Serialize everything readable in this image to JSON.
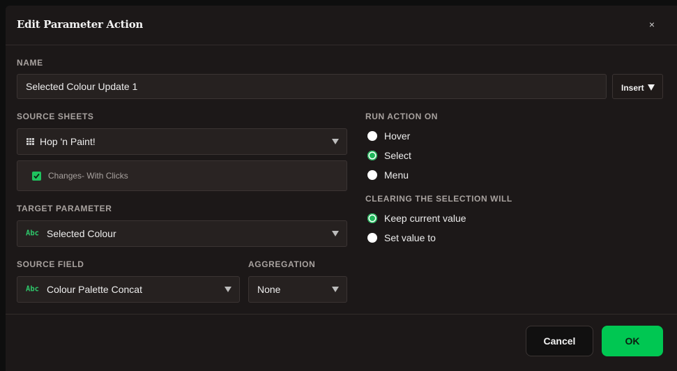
{
  "dialog": {
    "title": "Edit Parameter Action",
    "close_glyph": "×"
  },
  "name": {
    "label": "NAME",
    "value": "Selected Colour Update 1",
    "insert_label": "Insert"
  },
  "source_sheets": {
    "label": "SOURCE SHEETS",
    "selected": "Hop 'n Paint!",
    "icon": "sheet-grid-icon",
    "sheet_checkbox": {
      "label": "Changes- With Clicks",
      "checked": true
    }
  },
  "target_parameter": {
    "label": "TARGET PARAMETER",
    "type_badge": "Abc",
    "value": "Selected Colour"
  },
  "source_field": {
    "label": "SOURCE FIELD",
    "type_badge": "Abc",
    "value": "Colour Palette Concat"
  },
  "aggregation": {
    "label": "AGGREGATION",
    "value": "None"
  },
  "run_action_on": {
    "label": "RUN ACTION ON",
    "options": [
      {
        "label": "Hover",
        "selected": false
      },
      {
        "label": "Select",
        "selected": true
      },
      {
        "label": "Menu",
        "selected": false
      }
    ]
  },
  "clearing": {
    "label": "CLEARING THE SELECTION WILL",
    "options": [
      {
        "label": "Keep current value",
        "selected": true
      },
      {
        "label": "Set value to",
        "selected": false
      }
    ]
  },
  "footer": {
    "cancel_label": "Cancel",
    "ok_label": "OK"
  },
  "colors": {
    "accent": "#00c752",
    "badge_green": "#2ec66a",
    "background": "#1c1818"
  }
}
